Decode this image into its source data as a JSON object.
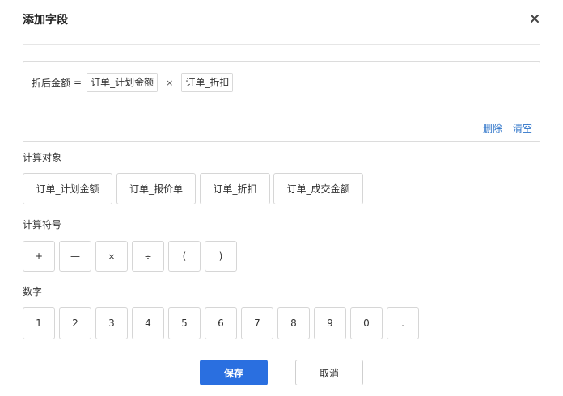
{
  "dialog": {
    "title": "添加字段",
    "close_icon": "close-icon"
  },
  "formula": {
    "lhs": "折后金额",
    "equals": "=",
    "tokens": [
      "订单_计划金额",
      "×",
      "订单_折扣"
    ],
    "actions": {
      "delete": "删除",
      "clear": "清空"
    }
  },
  "objects": {
    "label": "计算对象",
    "items": [
      "订单_计划金额",
      "订单_报价单",
      "订单_折扣",
      "订单_成交金额"
    ]
  },
  "operators": {
    "label": "计算符号",
    "items": [
      "+",
      "—",
      "×",
      "÷",
      "(",
      ")"
    ]
  },
  "numbers": {
    "label": "数字",
    "items": [
      "1",
      "2",
      "3",
      "4",
      "5",
      "6",
      "7",
      "8",
      "9",
      "0",
      "."
    ]
  },
  "footer": {
    "save": "保存",
    "cancel": "取消"
  },
  "colors": {
    "primary": "#2a6fe0",
    "link": "#2e74c9"
  }
}
